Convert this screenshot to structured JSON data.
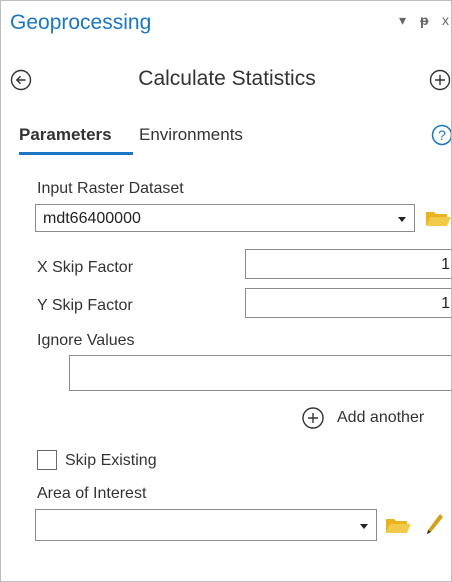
{
  "pane": {
    "title": "Geoprocessing",
    "controls": {
      "caret": "▾",
      "pin": "ᵽ",
      "close": "x"
    }
  },
  "tool": {
    "title": "Calculate Statistics",
    "back_icon": "back-circle-arrow-icon",
    "add_icon": "add-circle-icon"
  },
  "tabs": {
    "parameters": "Parameters",
    "environments": "Environments",
    "active": "Parameters",
    "help_icon": "help-circle-icon"
  },
  "params": {
    "input_raster": {
      "label": "Input Raster Dataset",
      "value": "mdt66400000"
    },
    "x_skip": {
      "label": "X Skip Factor",
      "value": "1"
    },
    "y_skip": {
      "label": "Y Skip Factor",
      "value": "1"
    },
    "ignore_values": {
      "label": "Ignore Values",
      "value": ""
    },
    "add_another": {
      "label": "Add another"
    },
    "skip_existing": {
      "label": "Skip Existing",
      "checked": false
    },
    "area_of_interest": {
      "label": "Area of Interest",
      "value": ""
    }
  },
  "colors": {
    "accent": "#1a76c2",
    "folder": "#e8b31c",
    "pencil": "#d4a017"
  }
}
